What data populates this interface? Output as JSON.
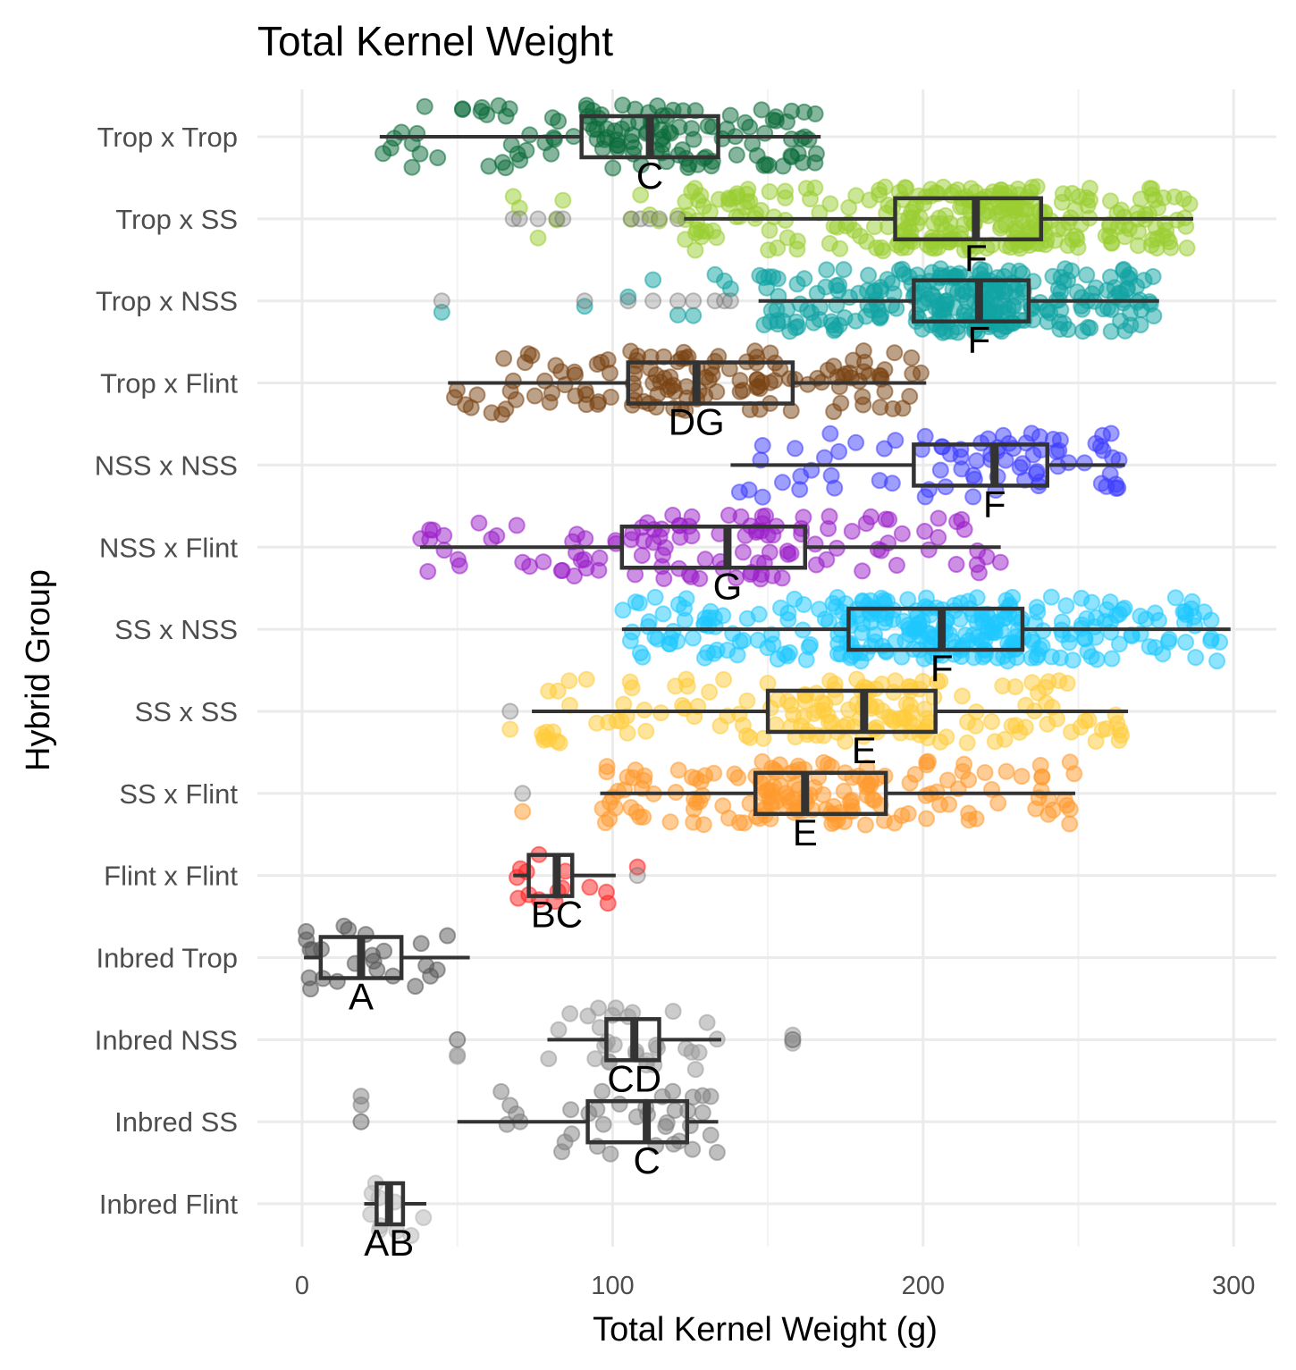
{
  "chart_data": {
    "type": "boxplot-jitter",
    "orientation": "horizontal",
    "title": "Total Kernel Weight",
    "xlabel": "Total Kernel Weight (g)",
    "ylabel": "Hybrid Group",
    "xlim": [
      -10,
      312
    ],
    "xticks": [
      0,
      100,
      200,
      300
    ],
    "xtick_labels": [
      "0",
      "100",
      "200",
      "300"
    ],
    "grid": true,
    "legend": "none",
    "groups": [
      {
        "name": "Trop x Trop",
        "color": "#0b6b3a",
        "letter": "C",
        "min": 25,
        "q1": 90,
        "median": 112,
        "q3": 134,
        "max": 167,
        "n": 130,
        "outliers": []
      },
      {
        "name": "Trop x SS",
        "color": "#9acd32",
        "letter": "F",
        "min": 123,
        "q1": 191,
        "median": 217,
        "q3": 238,
        "max": 287,
        "n": 300,
        "outliers": [
          68,
          70,
          76,
          82,
          84,
          106,
          109,
          112,
          115,
          121
        ]
      },
      {
        "name": "Trop x NSS",
        "color": "#12a3a3",
        "letter": "F",
        "min": 147,
        "q1": 197,
        "median": 218,
        "q3": 234,
        "max": 276,
        "n": 280,
        "outliers": [
          45,
          91,
          105,
          113,
          121,
          126,
          133,
          136,
          138
        ]
      },
      {
        "name": "Trop x Flint",
        "color": "#7a4413",
        "letter": "DG",
        "min": 47,
        "q1": 105,
        "median": 127,
        "q3": 158,
        "max": 201,
        "n": 140,
        "outliers": []
      },
      {
        "name": "NSS x NSS",
        "color": "#3d3dff",
        "letter": "F",
        "min": 138,
        "q1": 197,
        "median": 223,
        "q3": 240,
        "max": 265,
        "n": 80,
        "outliers": []
      },
      {
        "name": "NSS x Flint",
        "color": "#9b1fc9",
        "letter": "G",
        "min": 38,
        "q1": 103,
        "median": 137,
        "q3": 162,
        "max": 225,
        "n": 120,
        "outliers": []
      },
      {
        "name": "SS x NSS",
        "color": "#1ec8ff",
        "letter": "F",
        "min": 103,
        "q1": 176,
        "median": 206,
        "q3": 232,
        "max": 299,
        "n": 300,
        "outliers": []
      },
      {
        "name": "SS x SS",
        "color": "#ffcc3a",
        "letter": "E",
        "min": 74,
        "q1": 150,
        "median": 181,
        "q3": 204,
        "max": 266,
        "n": 170,
        "outliers": [
          67
        ]
      },
      {
        "name": "SS x Flint",
        "color": "#ff9a2e",
        "letter": "E",
        "min": 96,
        "q1": 146,
        "median": 162,
        "q3": 188,
        "max": 249,
        "n": 170,
        "outliers": [
          71
        ]
      },
      {
        "name": "Flint x Flint",
        "color": "#ff2020",
        "letter": "BC",
        "min": 68,
        "q1": 73,
        "median": 82,
        "q3": 87,
        "max": 101,
        "n": 14,
        "outliers": [
          108
        ]
      },
      {
        "name": "Inbred Trop",
        "color": "#555555",
        "letter": "A",
        "min": 0.6,
        "q1": 6,
        "median": 19,
        "q3": 32,
        "max": 54,
        "n": 24,
        "outliers": []
      },
      {
        "name": "Inbred NSS",
        "color": "#9a9a9a",
        "letter": "CD",
        "min": 79,
        "q1": 98,
        "median": 107,
        "q3": 115,
        "max": 135,
        "n": 30,
        "outliers": [
          50,
          50,
          158,
          158
        ]
      },
      {
        "name": "Inbred SS",
        "color": "#808080",
        "letter": "C",
        "min": 50,
        "q1": 92,
        "median": 111,
        "q3": 124,
        "max": 134,
        "n": 36,
        "outliers": [
          19,
          19
        ]
      },
      {
        "name": "Inbred Flint",
        "color": "#b3b3b3",
        "letter": "AB",
        "min": 20,
        "q1": 24,
        "median": 28,
        "q3": 32.5,
        "max": 40,
        "n": 10,
        "outliers": []
      }
    ]
  }
}
